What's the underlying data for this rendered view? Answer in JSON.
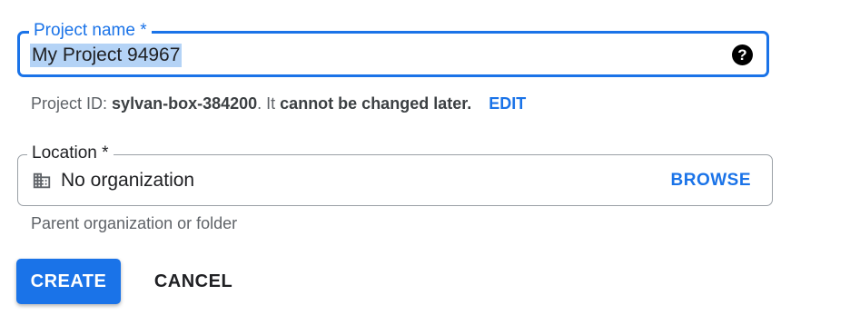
{
  "project_name": {
    "label": "Project name *",
    "value": "My Project 94967",
    "help_icon": "help-icon"
  },
  "project_id": {
    "prefix": "Project ID:",
    "id": "sylvan-box-384200",
    "mid": ". It",
    "warning": "cannot be changed later.",
    "edit_label": "EDIT"
  },
  "location": {
    "label": "Location *",
    "icon": "building-icon",
    "value": "No organization",
    "browse_label": "BROWSE",
    "helper": "Parent organization or folder"
  },
  "actions": {
    "create_label": "CREATE",
    "cancel_label": "CANCEL"
  },
  "colors": {
    "accent": "#1a73e8",
    "selection": "#b4d3f6",
    "outline": "#9aa0a6",
    "muted_text": "#5f6368"
  }
}
